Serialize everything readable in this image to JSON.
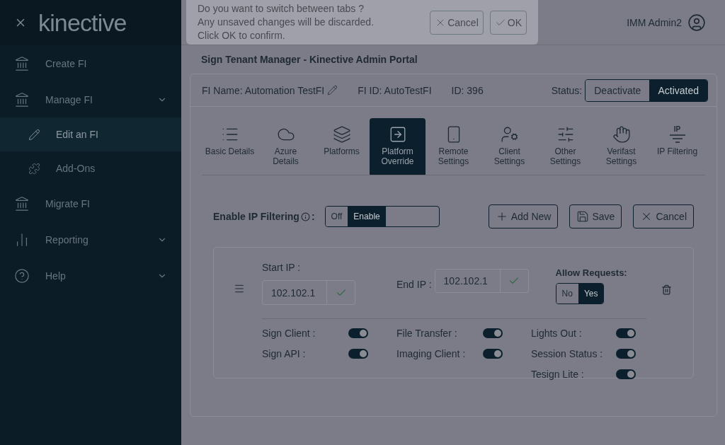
{
  "sidebar": {
    "logo": "kinective",
    "items": [
      {
        "label": "Create FI",
        "selected": false,
        "expandable": false
      },
      {
        "label": "Manage FI",
        "selected": false,
        "expandable": true,
        "children": [
          {
            "label": "Edit an FI",
            "selected": true
          },
          {
            "label": "Add-Ons",
            "selected": false
          }
        ]
      },
      {
        "label": "Migrate FI",
        "selected": false,
        "expandable": false
      },
      {
        "label": "Reporting",
        "selected": false,
        "expandable": true
      },
      {
        "label": "Help",
        "selected": false,
        "expandable": true
      }
    ]
  },
  "header": {
    "title": "Sign Tenant Manager - Kinective Admin Portal",
    "user": "IMM Admin2"
  },
  "fi": {
    "name": "FI Name: Automation TestFI",
    "fi_id": "FI ID: AutoTestFI",
    "id": "ID: 396",
    "status_label": "Status:",
    "status_options": [
      {
        "label": "Deactivate",
        "selected": false
      },
      {
        "label": "Activated",
        "selected": true
      }
    ]
  },
  "tabs": [
    {
      "label": "Basic Details",
      "selected": false
    },
    {
      "label": "Azure Details",
      "selected": false
    },
    {
      "label": "Platforms",
      "selected": false
    },
    {
      "label": "Platform Override",
      "selected": true
    },
    {
      "label": "Remote Settings",
      "selected": false
    },
    {
      "label": "Client Settings",
      "selected": false
    },
    {
      "label": "Other Settings",
      "selected": false
    },
    {
      "label": "Verifast Settings",
      "selected": false
    },
    {
      "label": "IP Filtering",
      "selected": false,
      "icon_text": "IP"
    }
  ],
  "ip_filtering": {
    "label": "Enable IP Filtering",
    "colon": ":",
    "options": [
      {
        "label": "Off",
        "selected": false
      },
      {
        "label": "Enable",
        "selected": true
      }
    ],
    "buttons": [
      "Add New",
      "Save",
      "Cancel"
    ]
  },
  "rule": {
    "start_ip_label": "Start IP :",
    "start_ip": "102.102.1",
    "end_ip_label": "End IP :",
    "end_ip": "102.102.1",
    "allow_label": "Allow Requests:",
    "allow_options": [
      {
        "label": "No",
        "selected": false
      },
      {
        "label": "Yes",
        "selected": true
      }
    ],
    "switch_columns": [
      [
        {
          "label": "Sign Client :",
          "on": true
        },
        {
          "label": "Sign API :",
          "on": true
        }
      ],
      [
        {
          "label": "File Transfer :",
          "on": true
        },
        {
          "label": "Imaging Client :",
          "on": true
        }
      ],
      [
        {
          "label": "Lights Out :",
          "on": true
        },
        {
          "label": "Session Status :",
          "on": true
        },
        {
          "label": "Tesign Lite :",
          "on": true
        }
      ]
    ]
  },
  "dialog": {
    "lines": [
      "Do you want to switch between tabs ?",
      "Any unsaved changes will be discarded.",
      "Click OK to confirm."
    ],
    "buttons": [
      "Cancel",
      "OK"
    ]
  }
}
